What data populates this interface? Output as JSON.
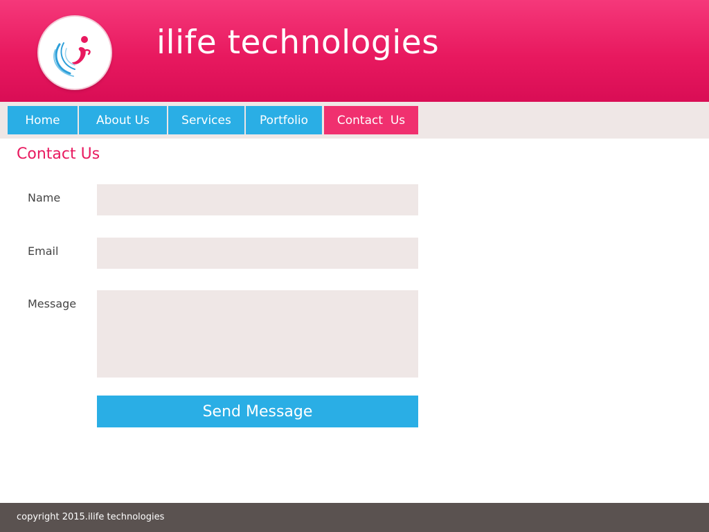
{
  "header": {
    "site_title": "ilife technologies",
    "logo_icon": "ilife-logo-icon"
  },
  "nav": {
    "items": [
      {
        "label": "Home",
        "active": false
      },
      {
        "label": "About Us",
        "active": false
      },
      {
        "label": "Services",
        "active": false
      },
      {
        "label": "Portfolio",
        "active": false
      },
      {
        "label": "Contact  Us",
        "active": true
      }
    ]
  },
  "main": {
    "heading": "Contact Us",
    "form": {
      "name_label": "Name",
      "name_value": "",
      "email_label": "Email",
      "email_value": "",
      "message_label": "Message",
      "message_value": "",
      "send_label": "Send Message"
    }
  },
  "footer": {
    "copyright": "copyright 2015.ilife technologies"
  },
  "colors": {
    "brand_pink": "#e8195f",
    "nav_blue": "#2aaee5",
    "nav_bar_bg": "#efe7e6",
    "footer_bg": "#5a5250"
  }
}
